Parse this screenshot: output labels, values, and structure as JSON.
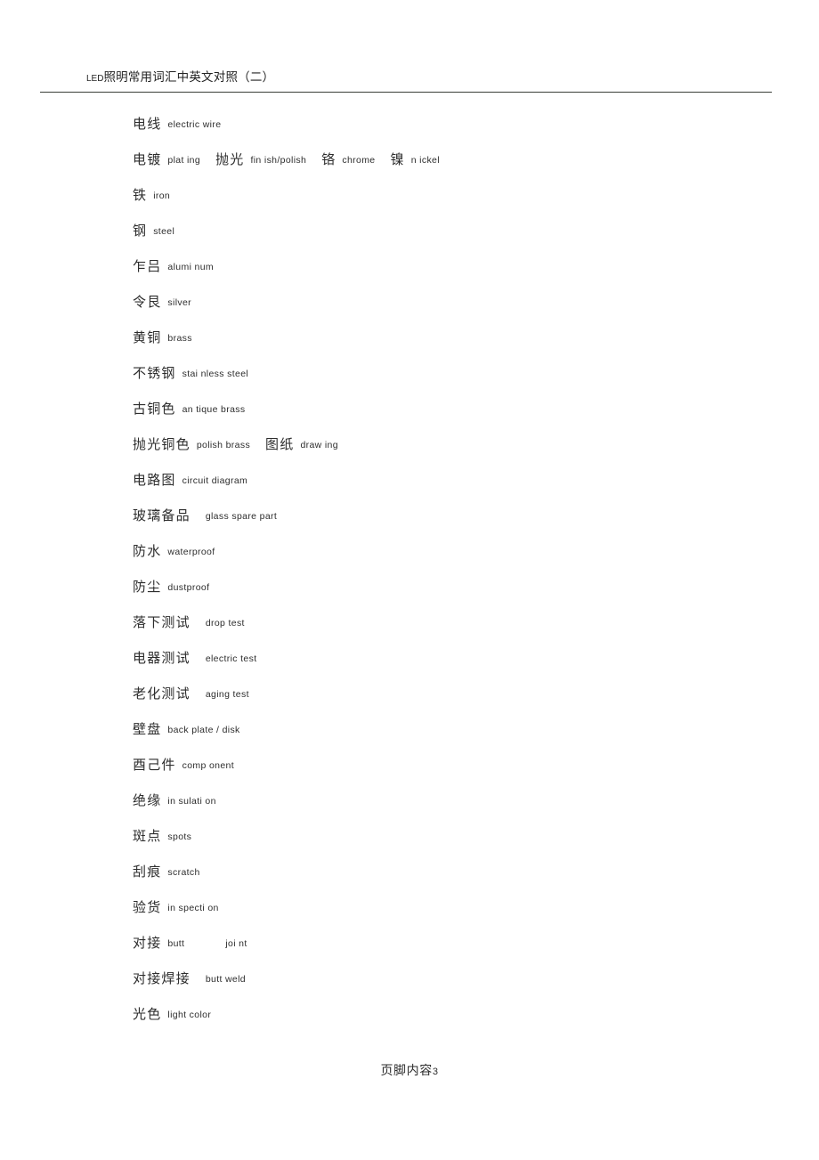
{
  "document": {
    "header": {
      "title_latin": "LED",
      "title_cjk": "照明常用词汇中英文对照（二）",
      "rule_color": "#3a3f38"
    },
    "footer": {
      "text_cjk": "页脚内容",
      "page_number": "3"
    },
    "text_color": "#2d2d2d",
    "background_color": "#ffffff"
  },
  "entries": [
    {
      "zh": "电线",
      "en": "electric wire",
      "gap": "sm"
    },
    {
      "zh": "电镀",
      "en": "plat ing",
      "gap": "sm",
      "extra": [
        {
          "zh": "抛光",
          "en": "fin ish/polish"
        },
        {
          "zh": "铬",
          "en": "chrome"
        },
        {
          "zh": "镍",
          "en": "n ickel"
        }
      ]
    },
    {
      "zh": "铁",
      "en": "iron",
      "gap": "sm"
    },
    {
      "zh": "钢",
      "en": "steel",
      "gap": "sm"
    },
    {
      "zh": "乍吕",
      "en": "alumi num",
      "gap": "sm"
    },
    {
      "zh": "令艮",
      "en": "silver",
      "gap": "sm"
    },
    {
      "zh": "黄铜",
      "en": "brass",
      "gap": "sm"
    },
    {
      "zh": "不锈钢",
      "en": "stai nless steel",
      "gap": "sm"
    },
    {
      "zh": "古铜色",
      "en": "an tique brass",
      "gap": "sm"
    },
    {
      "zh": "抛光铜色",
      "en": "polish brass",
      "gap": "sm",
      "extra": [
        {
          "zh": "图纸",
          "en": "draw ing"
        }
      ]
    },
    {
      "zh": "电路图",
      "en": "circuit diagram",
      "gap": "sm"
    },
    {
      "zh": "玻璃备品",
      "en": "glass spare part",
      "gap": "md"
    },
    {
      "zh": "防水",
      "en": "waterproof",
      "gap": "sm"
    },
    {
      "zh": "防尘",
      "en": "dustproof",
      "gap": "sm"
    },
    {
      "zh": "落下测试",
      "en": "drop test",
      "gap": "md"
    },
    {
      "zh": "电器测试",
      "en": "electric test",
      "gap": "md"
    },
    {
      "zh": "老化测试",
      "en": "aging test",
      "gap": "md"
    },
    {
      "zh": "壁盘",
      "en": "back plate / disk",
      "gap": "sm"
    },
    {
      "zh": "酉己件",
      "en": "comp onent",
      "gap": "sm"
    },
    {
      "zh": "绝缘",
      "en": "in sulati on",
      "gap": "sm"
    },
    {
      "zh": "斑点",
      "en": "spots",
      "gap": "sm"
    },
    {
      "zh": "刮痕",
      "en": "scratch",
      "gap": "sm"
    },
    {
      "zh": "验货",
      "en": "in specti on",
      "gap": "sm"
    },
    {
      "zh": "对接",
      "en": "butt",
      "gap": "sm",
      "extra": [
        {
          "zh": "",
          "en": "joi nt",
          "gap": "xl"
        }
      ]
    },
    {
      "zh": "对接焊接",
      "en": "butt weld",
      "gap": "md"
    },
    {
      "zh": "光色",
      "en": "light color",
      "gap": "sm"
    }
  ]
}
